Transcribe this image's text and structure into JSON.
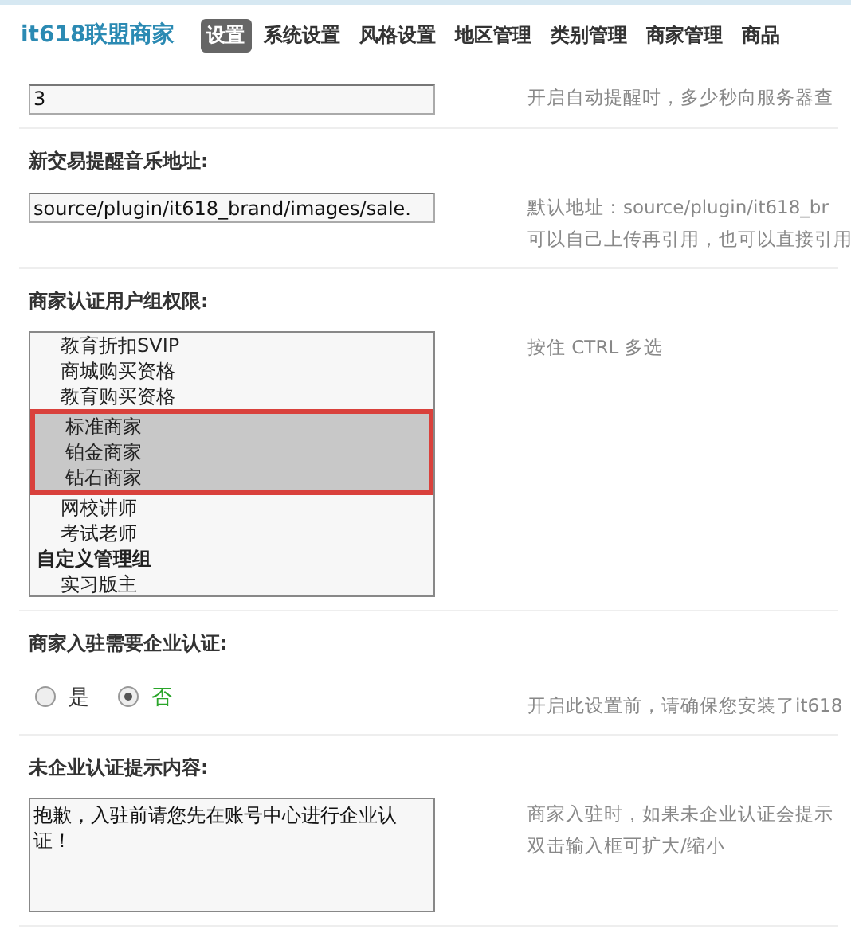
{
  "brand": "it618联盟商家",
  "nav": [
    {
      "label": "设置",
      "selected": true
    },
    {
      "label": "系统设置",
      "selected": false
    },
    {
      "label": "风格设置",
      "selected": false
    },
    {
      "label": "地区管理",
      "selected": false
    },
    {
      "label": "类别管理",
      "selected": false
    },
    {
      "label": "商家管理",
      "selected": false
    },
    {
      "label": "商品",
      "selected": false
    }
  ],
  "sections": [
    {
      "kind": "text",
      "value": "3",
      "hints": [
        "开启自动提醒时，多少秒向服务器查"
      ]
    },
    {
      "kind": "text",
      "title": "新交易提醒音乐地址:",
      "value": "source/plugin/it618_brand/images/sale.",
      "hints": [
        "默认地址：source/plugin/it618_br",
        "可以自己上传再引用，也可以直接引用"
      ]
    },
    {
      "kind": "multiselect",
      "title": "商家认证用户组权限:",
      "annotated": true,
      "hints": [
        "按住 CTRL 多选"
      ],
      "options": [
        {
          "kind": "option",
          "label": "教育折扣SVIP",
          "selected": false
        },
        {
          "kind": "option",
          "label": "商城购买资格",
          "selected": false
        },
        {
          "kind": "option",
          "label": "教育购买资格",
          "selected": false
        },
        {
          "kind": "option",
          "label": "标准商家",
          "selected": true
        },
        {
          "kind": "option",
          "label": "铂金商家",
          "selected": true
        },
        {
          "kind": "option",
          "label": "钻石商家",
          "selected": true
        },
        {
          "kind": "option",
          "label": "网校讲师",
          "selected": false
        },
        {
          "kind": "option",
          "label": "考试老师",
          "selected": false
        },
        {
          "kind": "group",
          "label": "自定义管理组",
          "selected": false
        },
        {
          "kind": "option",
          "label": "实习版主",
          "selected": false
        }
      ]
    },
    {
      "kind": "radio",
      "title": "商家入驻需要企业认证:",
      "hints": [
        "开启此设置前，请确保您安装了it618"
      ],
      "options": [
        {
          "label": "是",
          "selected": false
        },
        {
          "label": "否",
          "selected": true
        }
      ]
    },
    {
      "kind": "textarea",
      "title": "未企业认证提示内容:",
      "value": "抱歉，入驻前请您先在账号中心进行企业认证！",
      "hints": [
        "商家入驻时，如果未企业认证会提示",
        "双击输入框可扩大/缩小"
      ]
    }
  ]
}
